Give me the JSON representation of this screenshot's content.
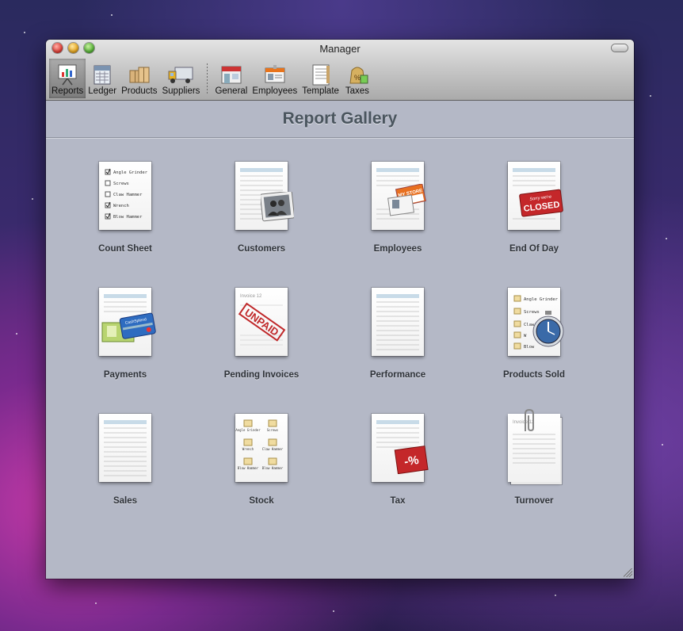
{
  "window": {
    "title": "Manager"
  },
  "toolbar": {
    "items": [
      {
        "label": "Reports",
        "icon": "reports-icon",
        "active": true
      },
      {
        "label": "Ledger",
        "icon": "ledger-icon"
      },
      {
        "label": "Products",
        "icon": "products-icon"
      },
      {
        "label": "Suppliers",
        "icon": "suppliers-icon"
      },
      {
        "label": "General",
        "icon": "general-icon"
      },
      {
        "label": "Employees",
        "icon": "employees-icon"
      },
      {
        "label": "Template",
        "icon": "template-icon"
      },
      {
        "label": "Taxes",
        "icon": "taxes-icon"
      }
    ]
  },
  "gallery": {
    "title": "Report Gallery",
    "reports": [
      {
        "label": "Count Sheet",
        "icon": "count-sheet-icon"
      },
      {
        "label": "Customers",
        "icon": "customers-icon"
      },
      {
        "label": "Employees",
        "icon": "employees-report-icon"
      },
      {
        "label": "End Of Day",
        "icon": "end-of-day-icon"
      },
      {
        "label": "Payments",
        "icon": "payments-icon"
      },
      {
        "label": "Pending Invoices",
        "icon": "pending-invoices-icon"
      },
      {
        "label": "Performance",
        "icon": "performance-icon"
      },
      {
        "label": "Products Sold",
        "icon": "products-sold-icon"
      },
      {
        "label": "Sales",
        "icon": "sales-icon"
      },
      {
        "label": "Stock",
        "icon": "stock-icon"
      },
      {
        "label": "Tax",
        "icon": "tax-icon"
      },
      {
        "label": "Turnover",
        "icon": "turnover-icon"
      }
    ]
  },
  "artwork": {
    "count_sheet_items": [
      "Angle Grinder",
      "Screws",
      "Claw Hammer",
      "Wrench",
      "Blow Hammer"
    ],
    "employee_badge": "MY STORE",
    "closed_sign_top": "Sorry we're",
    "closed_sign_main": "CLOSED",
    "card_text": "CashSplend",
    "invoice_title": "Invoice 12",
    "unpaid_stamp": "UNPAID",
    "products_sold_items": [
      "Angle Grinder",
      "Screws",
      "Claw",
      "W",
      "Blow"
    ],
    "stock_items": [
      "Angle Grinder",
      "Screws",
      "Wrench",
      "Claw Hammer",
      "Blow Hammer",
      "Blow Hammer"
    ],
    "tax_tag": "-%",
    "turnover_title": "Invoice 12"
  }
}
